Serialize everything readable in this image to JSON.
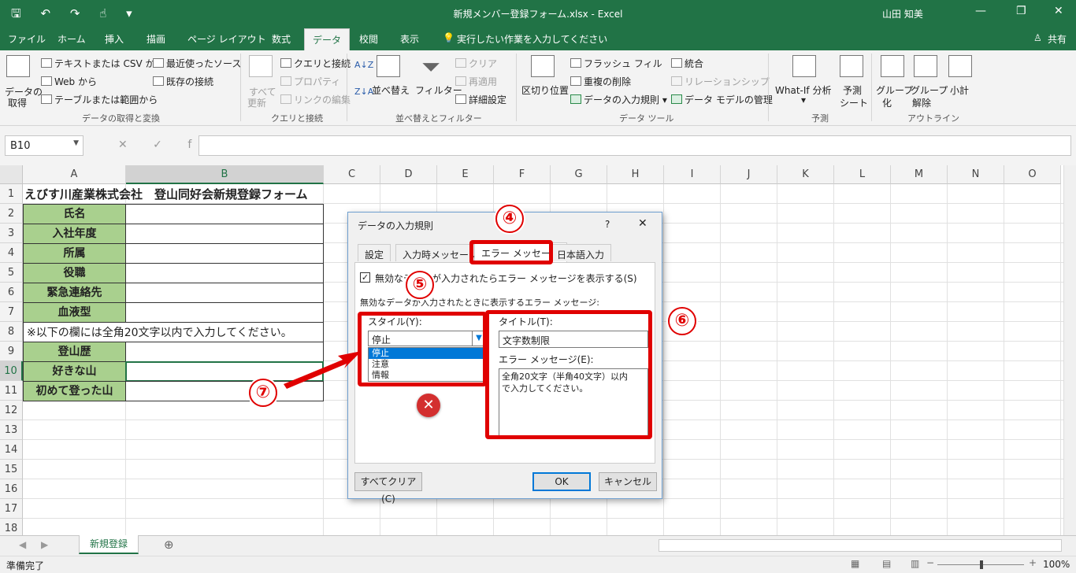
{
  "titlebar": {
    "qat": "🖫 ↶ ↷ ☝ ▾",
    "title": "新規メンバー登録フォーム.xlsx  -  Excel",
    "user": "山田 知美",
    "min": "—",
    "restore": "❐",
    "close": "✕"
  },
  "tabs": [
    "ファイル",
    "ホーム",
    "挿入",
    "描画",
    "ページ レイアウト",
    "数式",
    "データ",
    "校閲",
    "表示"
  ],
  "tell_me": "実行したい作業を入力してください",
  "share": "共有",
  "ribbon": {
    "get_data": "データの",
    "get_data2": "取得",
    "text_csv": "テキストまたは CSV から",
    "web": "Web から",
    "table_range": "テーブルまたは範囲から",
    "recent": "最近使ったソース",
    "existing": "既存の接続",
    "refresh": "すべて",
    "refresh2": "更新",
    "queries": "クエリと接続",
    "properties": "プロパティ",
    "edit_links": "リンクの編集",
    "sort": "並べ替え",
    "filter": "フィルター",
    "clear": "クリア",
    "reapply": "再適用",
    "advanced": "詳細設定",
    "text_to_cols": "区切り位置",
    "flash_fill": "フラッシュ フィル",
    "remove_dup": "重複の削除",
    "validation": "データの入力規則",
    "consolidate": "統合",
    "relationships": "リレーションシップ",
    "data_model": "データ モデルの管理",
    "whatif": "What-If 分析",
    "forecast": "予測",
    "forecast2": "シート",
    "group": "グループ",
    "group2": "化",
    "ungroup": "グループ",
    "ungroup2": "解除",
    "subtotal": "小計",
    "groups": {
      "g1": "データの取得と変換",
      "g2": "クエリと接続",
      "g3": "並べ替えとフィルター",
      "g4": "データ ツール",
      "g5": "予測",
      "g6": "アウトライン"
    }
  },
  "namebox": "B10",
  "fx": "✕ ✓ fx",
  "columns": [
    "A",
    "B",
    "C",
    "D",
    "E",
    "F",
    "G",
    "H",
    "I",
    "J",
    "K",
    "L",
    "M",
    "N",
    "O"
  ],
  "rows": [
    "1",
    "2",
    "3",
    "4",
    "5",
    "6",
    "7",
    "8",
    "9",
    "10",
    "11",
    "12",
    "13",
    "14",
    "15",
    "16",
    "17",
    "18"
  ],
  "sheet": {
    "title": "えびす川産業株式会社　登山同好会新規登録フォーム",
    "labels": [
      "氏名",
      "入社年度",
      "所属",
      "役職",
      "緊急連絡先",
      "血液型"
    ],
    "note": "※以下の欄には全角20文字以内で入力してください。",
    "labels2": [
      "登山歴",
      "好きな山",
      "初めて登った山"
    ]
  },
  "sheet_tab": "新規登録",
  "status": {
    "ready": "準備完了",
    "zoom": "100%"
  },
  "dialog": {
    "title": "データの入力規則",
    "help": "?",
    "close": "✕",
    "tabs": [
      "設定",
      "入力時メッセージ",
      "エラー メッセージ",
      "日本語入力"
    ],
    "show_error": "無効なデータが入力されたらエラー メッセージを表示する(S)",
    "section": "無効なデータが入力されたときに表示するエラー メッセージ:",
    "style_label": "スタイル(Y):",
    "style_value": "停止",
    "style_options": [
      "停止",
      "注意",
      "情報"
    ],
    "title_label": "タイトル(T):",
    "title_value": "文字数制限",
    "msg_label": "エラー メッセージ(E):",
    "msg_value": "全角20文字（半角40文字）以内で入力してください。",
    "clear_all": "すべてクリア(C)",
    "ok": "OK",
    "cancel": "キャンセル"
  },
  "annotations": [
    "④",
    "⑤",
    "⑥",
    "⑦"
  ]
}
